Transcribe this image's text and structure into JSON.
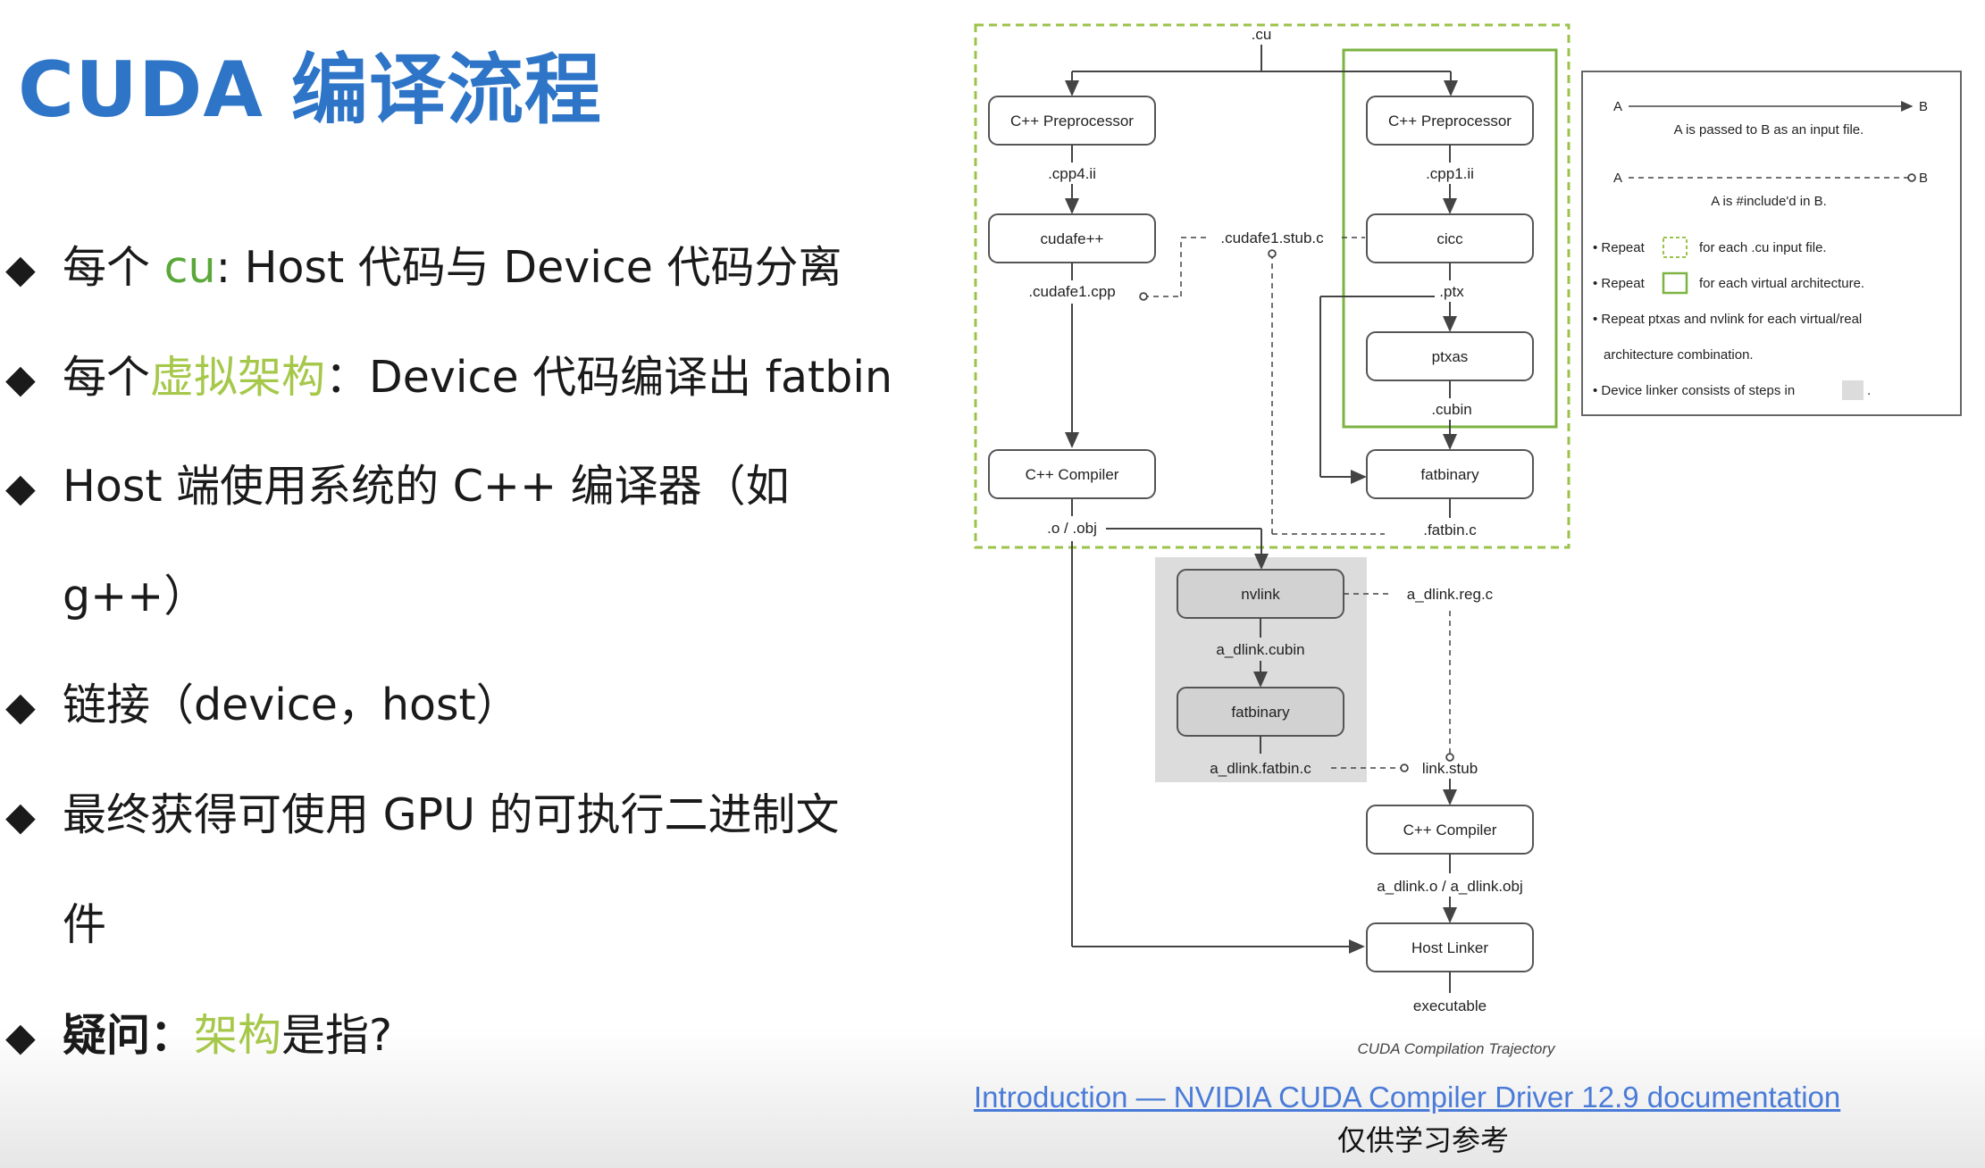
{
  "title": "CUDA 编译流程",
  "bullets": {
    "b1_pre": "每个 ",
    "b1_green": "cu",
    "b1_post": ": Host 代码与 Device 代码分离",
    "b2_pre": "每个",
    "b2_green": "虚拟架构",
    "b2_post": "：Device 代码编译出 fatbin",
    "b3_line1": "Host 端使用系统的 C++ 编译器（如",
    "b3_line2": "g++）",
    "b4": "链接（device，host）",
    "b5_line1": "最终获得可使用 GPU 的可执行二进制文",
    "b5_line2": "件",
    "b6_bold": "疑问：",
    "b6_green": "架构",
    "b6_post": "是指?",
    "bullet_char": "◆"
  },
  "diagram": {
    "cu": ".cu",
    "cpp_pre_left": "C++ Preprocessor",
    "cpp_pre_right": "C++ Preprocessor",
    "cpp4": ".cpp4.ii",
    "cpp1": ".cpp1.ii",
    "cudafe": "cudafe++",
    "cicc": "cicc",
    "stub_c": ".cudafe1.stub.c",
    "cudafe1_cpp": ".cudafe1.cpp",
    "ptx": ".ptx",
    "ptxas": "ptxas",
    "cubin": ".cubin",
    "cpp_compiler": "C++ Compiler",
    "fatbinary": "fatbinary",
    "obj": ".o / .obj",
    "fatbin_c": ".fatbin.c",
    "nvlink": "nvlink",
    "dlink_reg": "a_dlink.reg.c",
    "dlink_cubin": "a_dlink.cubin",
    "fatbinary2": "fatbinary",
    "dlink_fatbin": "a_dlink.fatbin.c",
    "link_stub": "link.stub",
    "cpp_compiler2": "C++ Compiler",
    "dlink_obj": "a_dlink.o / a_dlink.obj",
    "host_linker": "Host Linker",
    "executable": "executable",
    "caption": "CUDA Compilation Trajectory"
  },
  "legend": {
    "a1": "A",
    "b1": "B",
    "desc1": "A is passed to B as an input file.",
    "a2": "A",
    "b2": "B",
    "desc2": "A is #include'd in B.",
    "repeat1_pre": "• Repeat",
    "repeat1_post": "for each .cu input file.",
    "repeat2_pre": "• Repeat",
    "repeat2_post": "for each virtual architecture.",
    "repeat3_line1": "• Repeat ptxas and nvlink for each virtual/real",
    "repeat3_line2": "architecture combination.",
    "device_linker": "• Device linker consists of steps in",
    "period": "."
  },
  "colors": {
    "title": "#2e75c8",
    "green_text": "#a6c84a",
    "outer_dashed": "#9bc34a",
    "inner_box": "#7cb342",
    "device_linker_bg": "#dcdcdc",
    "link": "#4a7bd8"
  },
  "link_text": "Introduction — NVIDIA CUDA Compiler Driver 12.9 documentation",
  "footer_note": "仅供学习参考"
}
